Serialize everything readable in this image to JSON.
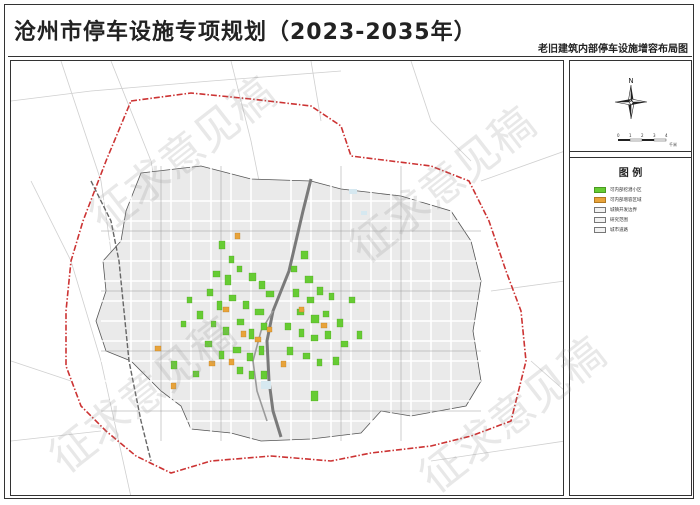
{
  "title": "沧州市停车设施专项规划（2023-2035年）",
  "subtitle": "老旧建筑内部停车设施增容布局图",
  "compass": {
    "north_label": "N",
    "icon": "north-arrow-icon",
    "scale_ticks": [
      "0",
      "1",
      "2",
      "3",
      "4"
    ],
    "scale_unit": "千米"
  },
  "legend": {
    "title": "图 例",
    "items": [
      {
        "label": "可内部挖潜小区",
        "color": "#66cc33"
      },
      {
        "label": "可内部增容区域",
        "color": "#e8a33a"
      },
      {
        "label": "城镇开发边界",
        "color": "#f2f2f2"
      },
      {
        "label": "研究范围",
        "color": "#f2f2f2"
      },
      {
        "label": "城市道路",
        "color": "#f2f2f2"
      }
    ]
  },
  "watermark": {
    "text": "征求意见稿"
  },
  "colors": {
    "boundary": "#cc3333",
    "green": "#66cc33",
    "orange": "#e8a33a",
    "river": "#888888",
    "road": "#bbbbbb",
    "land": "#e8e8e8"
  }
}
